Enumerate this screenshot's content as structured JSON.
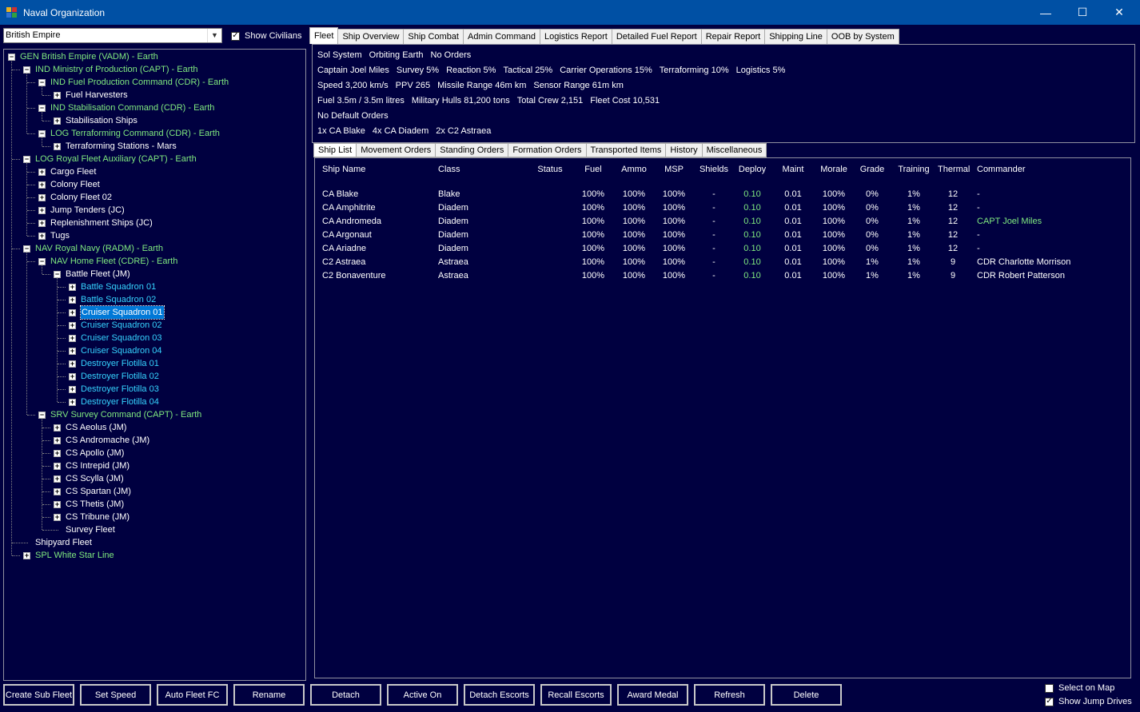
{
  "window": {
    "title": "Naval Organization",
    "controls": [
      "—",
      "☐",
      "✕"
    ]
  },
  "empire_select": {
    "value": "British Empire"
  },
  "show_civilians": {
    "label": "Show Civilians",
    "checked": true
  },
  "tree": [
    {
      "label": "GEN British Empire  (VADM)  -  Earth",
      "color": "green",
      "level": 0,
      "expander": "−"
    },
    {
      "label": "IND Ministry of Production  (CAPT)  -  Earth",
      "color": "green",
      "level": 1,
      "expander": "−"
    },
    {
      "label": "IND Fuel Production Command  (CDR)  -  Earth",
      "color": "green",
      "level": 2,
      "expander": "−"
    },
    {
      "label": "Fuel Harvesters",
      "color": "white",
      "level": 3,
      "expander": "+"
    },
    {
      "label": "IND Stabilisation Command  (CDR)  -  Earth",
      "color": "green",
      "level": 2,
      "expander": "−"
    },
    {
      "label": "Stabilisation Ships",
      "color": "white",
      "level": 3,
      "expander": "+"
    },
    {
      "label": "LOG Terraforming Command  (CDR)  -  Earth",
      "color": "green",
      "level": 2,
      "expander": "−"
    },
    {
      "label": "Terraforming Stations - Mars",
      "color": "white",
      "level": 3,
      "expander": "+"
    },
    {
      "label": "LOG Royal Fleet Auxiliary  (CAPT)  -  Earth",
      "color": "green",
      "level": 1,
      "expander": "−"
    },
    {
      "label": "Cargo Fleet",
      "color": "white",
      "level": 2,
      "expander": "+"
    },
    {
      "label": "Colony Fleet",
      "color": "white",
      "level": 2,
      "expander": "+"
    },
    {
      "label": "Colony Fleet 02",
      "color": "white",
      "level": 2,
      "expander": "+"
    },
    {
      "label": "Jump Tenders  (JC)",
      "color": "white",
      "level": 2,
      "expander": "+"
    },
    {
      "label": "Replenishment Ships  (JC)",
      "color": "white",
      "level": 2,
      "expander": "+"
    },
    {
      "label": "Tugs",
      "color": "white",
      "level": 2,
      "expander": "+"
    },
    {
      "label": "NAV Royal Navy  (RADM)  -  Earth",
      "color": "green",
      "level": 1,
      "expander": "−"
    },
    {
      "label": "NAV Home Fleet  (CDRE)  -  Earth",
      "color": "green",
      "level": 2,
      "expander": "−"
    },
    {
      "label": "Battle Fleet  (JM)",
      "color": "white",
      "level": 3,
      "expander": "−"
    },
    {
      "label": "Battle Squadron 01",
      "color": "cyan",
      "level": 4,
      "expander": "+"
    },
    {
      "label": "Battle Squadron 02",
      "color": "cyan",
      "level": 4,
      "expander": "+"
    },
    {
      "label": "Cruiser Squadron 01",
      "color": "cyan",
      "level": 4,
      "expander": "+",
      "selected": true
    },
    {
      "label": "Cruiser Squadron 02",
      "color": "cyan",
      "level": 4,
      "expander": "+"
    },
    {
      "label": "Cruiser Squadron 03",
      "color": "cyan",
      "level": 4,
      "expander": "+"
    },
    {
      "label": "Cruiser Squadron 04",
      "color": "cyan",
      "level": 4,
      "expander": "+"
    },
    {
      "label": "Destroyer Flotilla 01",
      "color": "cyan",
      "level": 4,
      "expander": "+"
    },
    {
      "label": "Destroyer Flotilla 02",
      "color": "cyan",
      "level": 4,
      "expander": "+"
    },
    {
      "label": "Destroyer Flotilla 03",
      "color": "cyan",
      "level": 4,
      "expander": "+"
    },
    {
      "label": "Destroyer Flotilla 04",
      "color": "cyan",
      "level": 4,
      "expander": "+"
    },
    {
      "label": "SRV Survey Command  (CAPT)  -  Earth",
      "color": "green",
      "level": 2,
      "expander": "−"
    },
    {
      "label": "CS Aeolus  (JM)",
      "color": "white",
      "level": 3,
      "expander": "+"
    },
    {
      "label": "CS Andromache  (JM)",
      "color": "white",
      "level": 3,
      "expander": "+"
    },
    {
      "label": "CS Apollo  (JM)",
      "color": "white",
      "level": 3,
      "expander": "+"
    },
    {
      "label": "CS Intrepid  (JM)",
      "color": "white",
      "level": 3,
      "expander": "+"
    },
    {
      "label": "CS Scylla  (JM)",
      "color": "white",
      "level": 3,
      "expander": "+"
    },
    {
      "label": "CS Spartan  (JM)",
      "color": "white",
      "level": 3,
      "expander": "+"
    },
    {
      "label": "CS Thetis  (JM)",
      "color": "white",
      "level": 3,
      "expander": "+"
    },
    {
      "label": "CS Tribune  (JM)",
      "color": "white",
      "level": 3,
      "expander": "+"
    },
    {
      "label": "Survey Fleet",
      "color": "white",
      "level": 3,
      "expander": ""
    },
    {
      "label": "Shipyard Fleet",
      "color": "white",
      "level": 1,
      "expander": ""
    },
    {
      "label": "SPL White Star Line",
      "color": "green",
      "level": 1,
      "expander": "+"
    }
  ],
  "tabs": [
    "Fleet",
    "Ship Overview",
    "Ship Combat",
    "Admin Command",
    "Logistics Report",
    "Detailed Fuel Report",
    "Repair Report",
    "Shipping Line",
    "OOB by System"
  ],
  "active_tab": "Fleet",
  "info": [
    [
      "Sol System",
      "Orbiting Earth",
      "No Orders"
    ],
    [
      "Captain Joel Miles",
      "Survey 5%",
      "Reaction 5%",
      "Tactical 25%",
      "Carrier Operations 15%",
      "Terraforming 10%",
      "Logistics 5%"
    ],
    [
      "Speed 3,200 km/s",
      "PPV 265",
      "Missile Range 46m  km",
      "Sensor Range 61m  km"
    ],
    [
      "Fuel 3.5m / 3.5m litres",
      "Military Hulls 81,200 tons",
      "Total Crew 2,151",
      "Fleet Cost 10,531"
    ],
    [
      "No Default Orders"
    ],
    [
      "1x CA Blake",
      "4x CA Diadem",
      "2x C2 Astraea"
    ]
  ],
  "subtabs": [
    "Ship List",
    "Movement Orders",
    "Standing Orders",
    "Formation Orders",
    "Transported Items",
    "History",
    "Miscellaneous"
  ],
  "active_subtab": "Ship List",
  "ship_columns": [
    "Ship Name",
    "Class",
    "Status",
    "Fuel",
    "Ammo",
    "MSP",
    "Shields",
    "Deploy",
    "Maint",
    "Morale",
    "Grade",
    "Training",
    "Thermal",
    "Commander"
  ],
  "ships": [
    {
      "name": "CA Blake",
      "class": "Blake",
      "status": "",
      "fuel": "100%",
      "ammo": "100%",
      "msp": "100%",
      "shields": "-",
      "deploy": "0.10",
      "maint": "0.01",
      "morale": "100%",
      "grade": "0%",
      "training": "1%",
      "thermal": "12",
      "commander": "-",
      "commander_highlight": false
    },
    {
      "name": "CA Amphitrite",
      "class": "Diadem",
      "status": "",
      "fuel": "100%",
      "ammo": "100%",
      "msp": "100%",
      "shields": "-",
      "deploy": "0.10",
      "maint": "0.01",
      "morale": "100%",
      "grade": "0%",
      "training": "1%",
      "thermal": "12",
      "commander": "-",
      "commander_highlight": false
    },
    {
      "name": "CA Andromeda",
      "class": "Diadem",
      "status": "",
      "fuel": "100%",
      "ammo": "100%",
      "msp": "100%",
      "shields": "-",
      "deploy": "0.10",
      "maint": "0.01",
      "morale": "100%",
      "grade": "0%",
      "training": "1%",
      "thermal": "12",
      "commander": "CAPT Joel Miles",
      "commander_highlight": true
    },
    {
      "name": "CA Argonaut",
      "class": "Diadem",
      "status": "",
      "fuel": "100%",
      "ammo": "100%",
      "msp": "100%",
      "shields": "-",
      "deploy": "0.10",
      "maint": "0.01",
      "morale": "100%",
      "grade": "0%",
      "training": "1%",
      "thermal": "12",
      "commander": "-",
      "commander_highlight": false
    },
    {
      "name": "CA Ariadne",
      "class": "Diadem",
      "status": "",
      "fuel": "100%",
      "ammo": "100%",
      "msp": "100%",
      "shields": "-",
      "deploy": "0.10",
      "maint": "0.01",
      "morale": "100%",
      "grade": "0%",
      "training": "1%",
      "thermal": "12",
      "commander": "-",
      "commander_highlight": false
    },
    {
      "name": "C2 Astraea",
      "class": "Astraea",
      "status": "",
      "fuel": "100%",
      "ammo": "100%",
      "msp": "100%",
      "shields": "-",
      "deploy": "0.10",
      "maint": "0.01",
      "morale": "100%",
      "grade": "1%",
      "training": "1%",
      "thermal": "9",
      "commander": "CDR Charlotte Morrison",
      "commander_highlight": false
    },
    {
      "name": "C2 Bonaventure",
      "class": "Astraea",
      "status": "",
      "fuel": "100%",
      "ammo": "100%",
      "msp": "100%",
      "shields": "-",
      "deploy": "0.10",
      "maint": "0.01",
      "morale": "100%",
      "grade": "1%",
      "training": "1%",
      "thermal": "9",
      "commander": "CDR Robert Patterson",
      "commander_highlight": false
    }
  ],
  "buttons": [
    "Create Sub Fleet",
    "Set Speed",
    "Auto Fleet FC",
    "Rename",
    "Detach",
    "Active On",
    "Detach Escorts",
    "Recall Escorts",
    "Award Medal",
    "Refresh",
    "Delete"
  ],
  "select_on_map": {
    "label": "Select on Map",
    "checked": false
  },
  "show_jump_drives": {
    "label": "Show Jump Drives",
    "checked": true
  },
  "colors": {
    "background": "#000040",
    "titlebar": "#0050a4",
    "green": "#7fe87f",
    "cyan": "#35d3ff",
    "selection": "#0078d7"
  }
}
